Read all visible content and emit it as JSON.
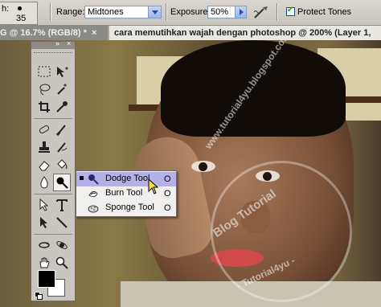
{
  "options_bar": {
    "brush_label": "h:",
    "brush_size": "35",
    "range_label": "Range:",
    "range_value": "Midtones",
    "exposure_label": "Exposure:",
    "exposure_value": "50%",
    "protect_tones_label": "Protect Tones",
    "protect_tones_checked": true
  },
  "tabs": [
    {
      "label": "G @ 16.7% (RGB/8) *",
      "close": "×"
    },
    {
      "label": "cara memutihkan wajah dengan photoshop @ 200% (Layer 1,"
    }
  ],
  "toolbox": {
    "header_collapse": "»",
    "header_close": "×",
    "foreground_color": "#000000",
    "background_color": "#ffffff"
  },
  "flyout": {
    "items": [
      {
        "label": "Dodge Tool",
        "key": "O",
        "icon": "dodge-icon",
        "selected": true
      },
      {
        "label": "Burn Tool",
        "key": "O",
        "icon": "burn-icon",
        "selected": false
      },
      {
        "label": "Sponge Tool",
        "key": "O",
        "icon": "sponge-icon",
        "selected": false
      }
    ]
  },
  "canvas": {
    "watermark_lines": [
      "www.tutorial4yu.blogspot.com",
      "Blog Tutorial",
      "- Tutorial4yu -"
    ]
  },
  "colors": {
    "flyout_highlight": "#b5b1e8",
    "toolbox_bg": "#c9c6c0",
    "options_bar_bg": "#d9d6cf"
  }
}
